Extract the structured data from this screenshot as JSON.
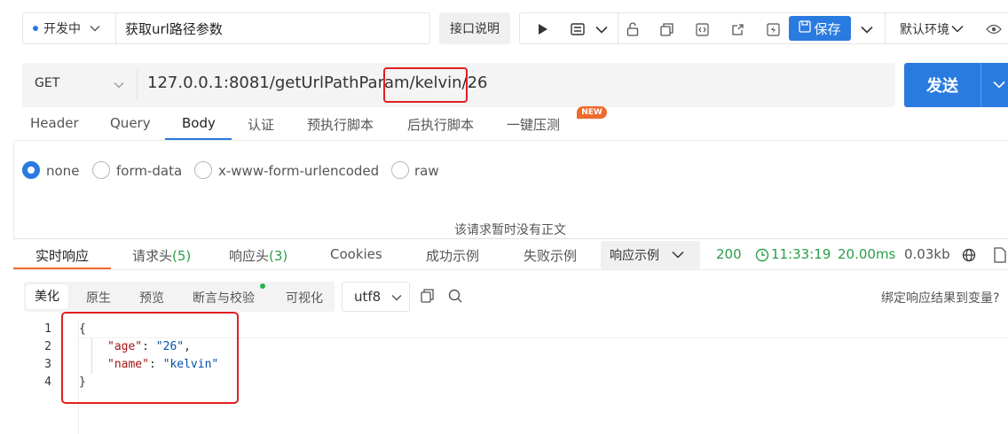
{
  "toolbar": {
    "status": "开发中",
    "api_name": "获取url路径参数",
    "doc_button": "接口说明",
    "save_label": "保存",
    "environment": "默认环境"
  },
  "request": {
    "method": "GET",
    "url": "127.0.0.1:8081/getUrlPathParam/kelvin/26",
    "send_label": "发送"
  },
  "request_tabs": [
    "Header",
    "Query",
    "Body",
    "认证",
    "预执行脚本",
    "后执行脚本",
    "一键压测"
  ],
  "request_active_tab": "Body",
  "new_badge": "NEW",
  "body_types": [
    "none",
    "form-data",
    "x-www-form-urlencoded",
    "raw"
  ],
  "body_selected": "none",
  "body_empty_text": "该请求暂时没有正文",
  "response_tabs": {
    "realtime": "实时响应",
    "req_headers": "请求头",
    "req_headers_count": "(5)",
    "resp_headers": "响应头",
    "resp_headers_count": "(3)",
    "cookies": "Cookies",
    "success_example": "成功示例",
    "fail_example": "失败示例"
  },
  "example_select": "响应示例",
  "response_status": {
    "code": "200",
    "time": "11:33:19",
    "duration": "20.00ms",
    "size": "0.03kb"
  },
  "view_modes": [
    "美化",
    "原生",
    "预览",
    "断言与校验",
    "可视化"
  ],
  "view_active": "美化",
  "encoding": "utf8",
  "bind_text": "绑定响应结果到变量?",
  "code": {
    "line_numbers": [
      "1",
      "2",
      "3",
      "4"
    ],
    "brace_open": "{",
    "brace_close": "}",
    "key_age": "\"age\"",
    "val_age": "\"26\"",
    "key_name": "\"name\"",
    "val_name": "\"kelvin\""
  },
  "colors": {
    "primary": "#2a7be0",
    "success": "#2a9d4a",
    "highlight": "#e02020",
    "accent": "#f06a2d"
  }
}
